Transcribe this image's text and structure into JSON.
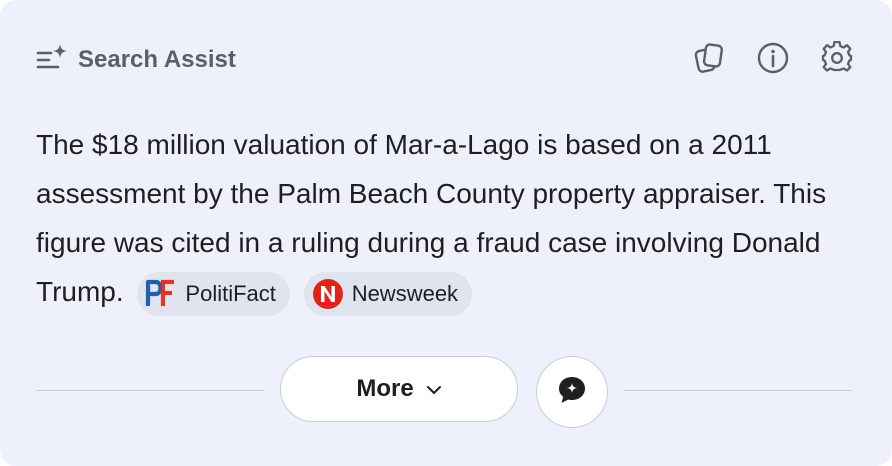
{
  "search_assist": {
    "title": "Search Assist",
    "title_icon": "sparkle-list-icon",
    "actions": [
      {
        "name": "copy",
        "icon": "copy-icon"
      },
      {
        "name": "info",
        "icon": "info-icon"
      },
      {
        "name": "settings",
        "icon": "gear-icon"
      }
    ]
  },
  "answer": {
    "text": "The $18 million valuation of Mar-a-Lago is based on a 2011 assessment by the Palm Beach County property appraiser. This figure was cited in a ruling during a fraud case involving Donald Trump.",
    "sources": [
      {
        "label": "PolitiFact",
        "logo_text": "PF",
        "icon": "politifact-logo"
      },
      {
        "label": "Newsweek",
        "logo_text": "N",
        "icon": "newsweek-logo"
      }
    ]
  },
  "footer": {
    "more_label": "More",
    "more_icon": "chevron-down-icon",
    "chat_icon": "chat-bubble-icon"
  },
  "colors": {
    "card_background": "#eef1fb",
    "chip_background": "#e0e4ee",
    "newsweek_red": "#e2231a",
    "politifact_blue": "#1f5fae",
    "politifact_red": "#e0352b"
  }
}
